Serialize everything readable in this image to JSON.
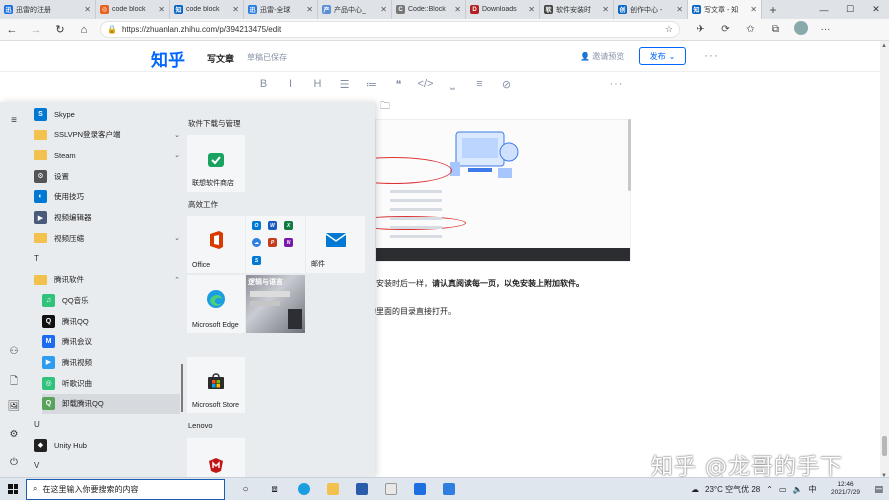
{
  "browser": {
    "tabs": [
      {
        "label": "迅雷的注册",
        "fav_color": "#1e6fe0",
        "fav_glyph": "迅",
        "active": false
      },
      {
        "label": "code block",
        "fav_color": "#e8621d",
        "fav_glyph": "◎",
        "active": false
      },
      {
        "label": "code block",
        "fav_color": "#0a66c2",
        "fav_glyph": "知",
        "active": false
      },
      {
        "label": "迅雷-全球",
        "fav_color": "#2a7be4",
        "fav_glyph": "迅",
        "active": false
      },
      {
        "label": "产品中心_",
        "fav_color": "#5a8fd8",
        "fav_glyph": "产",
        "active": false
      },
      {
        "label": "Code::Block",
        "fav_color": "#777777",
        "fav_glyph": "C",
        "active": false
      },
      {
        "label": "Downloads",
        "fav_color": "#b22222",
        "fav_glyph": "D",
        "active": false
      },
      {
        "label": "软件安装时",
        "fav_color": "#444444",
        "fav_glyph": "软",
        "active": false
      },
      {
        "label": "创作中心 -",
        "fav_color": "#0a66c2",
        "fav_glyph": "创",
        "active": false
      },
      {
        "label": "写文章 - 知",
        "fav_color": "#0a66c2",
        "fav_glyph": "知",
        "active": true
      }
    ],
    "new_tab": "+",
    "window_controls": {
      "minimize": "—",
      "maximize": "☐",
      "close": "✕"
    },
    "url": "https://zhuanlan.zhihu.com/p/394213475/edit"
  },
  "zhihu": {
    "logo": "知乎",
    "write_article": "写文章",
    "draft_status": "草稿已保存",
    "invite_preview": "邀请预览",
    "publish": "发布",
    "more": "···",
    "toolbar": [
      "B",
      "I",
      "H",
      "☰",
      "≔",
      "❝",
      "</>",
      "⎵",
      "≡",
      "⊘"
    ],
    "toolbar_more": "···",
    "para1_normal": "安装时后一样，",
    "para1_bold": "请认真阅读每一页，以免安装上附加软件。",
    "para2": "的里面的目录直接打开。",
    "watermark": "知乎 @龙哥的手下"
  },
  "start_menu": {
    "rail": {
      "hamburger": "≡",
      "user": "user-icon",
      "document": "document-icon",
      "pictures": "pictures-icon",
      "settings": "gear-icon",
      "power": "power-icon"
    },
    "apps": [
      {
        "label": "Skype",
        "type": "app",
        "color": "#0078d4",
        "glyph": "S"
      },
      {
        "label": "SSLVPN登录客户端",
        "type": "folder",
        "chev": "⌄"
      },
      {
        "label": "Steam",
        "type": "folder",
        "chev": "⌄"
      },
      {
        "label": "设置",
        "type": "app",
        "color": "#555555",
        "glyph": "⚙"
      },
      {
        "label": "使用技巧",
        "type": "app",
        "color": "#0078d4",
        "glyph": "◐"
      },
      {
        "label": "视频编辑器",
        "type": "app",
        "color": "#4a5a7a",
        "glyph": "▶"
      },
      {
        "label": "视频压缩",
        "type": "folder",
        "chev": "⌄"
      },
      {
        "label": "T",
        "type": "letter"
      },
      {
        "label": "腾讯软件",
        "type": "folder",
        "chev": "⌃"
      },
      {
        "label": "QQ音乐",
        "type": "sub",
        "color": "#31c27c",
        "glyph": "♫"
      },
      {
        "label": "腾讯QQ",
        "type": "sub",
        "color": "#111111",
        "glyph": "Q"
      },
      {
        "label": "腾讯会议",
        "type": "sub",
        "color": "#1c6bf1",
        "glyph": "M"
      },
      {
        "label": "腾讯视频",
        "type": "sub",
        "color": "#2e9cf0",
        "glyph": "▶"
      },
      {
        "label": "听歌识曲",
        "type": "sub",
        "color": "#31c27c",
        "glyph": "◎"
      },
      {
        "label": "卸载腾讯QQ",
        "type": "sub",
        "color": "#5aa35a",
        "glyph": "Q",
        "selected": true
      },
      {
        "label": "U",
        "type": "letter"
      },
      {
        "label": "Unity Hub",
        "type": "app",
        "color": "#222222",
        "glyph": "◆"
      },
      {
        "label": "V",
        "type": "letter"
      }
    ],
    "groups": {
      "g1": "软件下载与管理",
      "g2": "高效工作",
      "g3": "Lenovo"
    },
    "tiles": {
      "lenovo_store": "联想软件商店",
      "office": "Office",
      "mail": "邮件",
      "edge": "Microsoft Edge",
      "store": "Microsoft Store",
      "photo_text": "逻辑与语言"
    }
  },
  "taskbar": {
    "search_placeholder": "在这里输入你要搜索的内容",
    "weather": "23°C 空气优 28",
    "time": "12:46",
    "date": "2021/7/29"
  }
}
